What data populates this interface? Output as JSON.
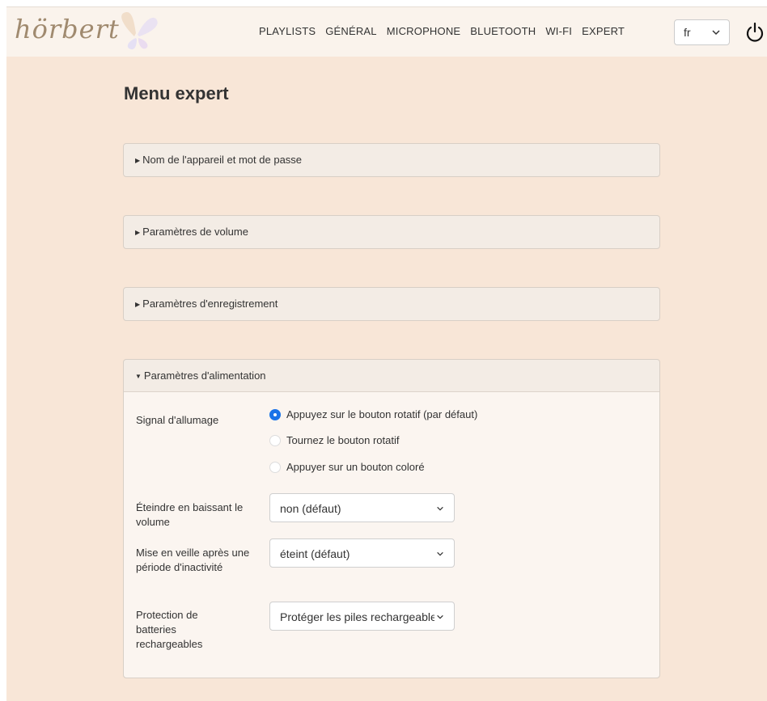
{
  "brand": {
    "name": "hörbert"
  },
  "nav": {
    "items": [
      "PLAYLISTS",
      "GÉNÉRAL",
      "MICROPHONE",
      "BLUETOOTH",
      "WI-FI",
      "EXPERT"
    ],
    "language": "fr",
    "power_icon": "power-icon"
  },
  "page": {
    "title": "Menu expert"
  },
  "panels": [
    {
      "label": "Nom de l'appareil et mot de passe",
      "expanded": false
    },
    {
      "label": "Paramètres de volume",
      "expanded": false
    },
    {
      "label": "Paramètres d'enregistrement",
      "expanded": false
    },
    {
      "label": "Paramètres d'alimentation",
      "expanded": true
    }
  ],
  "power": {
    "signal_label": "Signal d'allumage",
    "signal_options": [
      {
        "label": "Appuyez sur le bouton rotatif (par défaut)",
        "checked": true
      },
      {
        "label": "Tournez le bouton rotatif",
        "checked": false
      },
      {
        "label": "Appuyer sur un bouton coloré",
        "checked": false
      }
    ],
    "volume_off_label": "Éteindre en baissant le volume",
    "volume_off_value": "non (défaut)",
    "sleep_label": "Mise en veille après une période d'inactivité",
    "sleep_value": "éteint (défaut)",
    "battery_label": "Protection de batteries rechargeables",
    "battery_value": "Protéger les piles rechargeables"
  },
  "colors": {
    "accent": "#1a73e8",
    "page_bg": "#f8e6d7",
    "nav_bg": "#faf3ec"
  }
}
